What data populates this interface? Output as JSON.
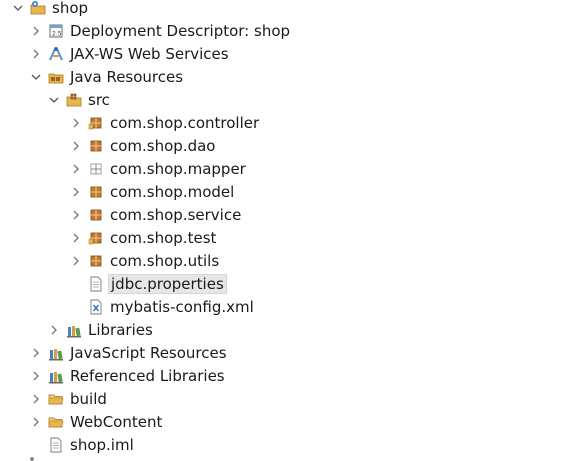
{
  "tree": {
    "project": {
      "label": "shop",
      "icon": "project-icon",
      "state": "expanded"
    },
    "deployment_descriptor": {
      "label": "Deployment Descriptor: shop",
      "icon": "deployment-descriptor-icon",
      "state": "collapsed"
    },
    "jaxws": {
      "label": "JAX-WS Web Services",
      "icon": "web-services-icon",
      "state": "collapsed"
    },
    "java_resources": {
      "label": "Java Resources",
      "icon": "java-resources-icon",
      "state": "expanded"
    },
    "src": {
      "label": "src",
      "icon": "source-folder-icon",
      "state": "expanded"
    },
    "packages": [
      {
        "label": "com.shop.controller",
        "icon": "package-icon",
        "state": "collapsed"
      },
      {
        "label": "com.shop.dao",
        "icon": "package-icon",
        "state": "collapsed"
      },
      {
        "label": "com.shop.mapper",
        "icon": "empty-package-icon",
        "state": "collapsed"
      },
      {
        "label": "com.shop.model",
        "icon": "package-icon",
        "state": "collapsed"
      },
      {
        "label": "com.shop.service",
        "icon": "package-icon",
        "state": "collapsed"
      },
      {
        "label": "com.shop.test",
        "icon": "package-icon",
        "state": "collapsed"
      },
      {
        "label": "com.shop.utils",
        "icon": "package-icon",
        "state": "collapsed"
      }
    ],
    "src_files": [
      {
        "label": "jdbc.properties",
        "icon": "properties-file-icon",
        "selected": true
      },
      {
        "label": "mybatis-config.xml",
        "icon": "xml-file-icon",
        "selected": false
      }
    ],
    "libraries": {
      "label": "Libraries",
      "icon": "libraries-icon",
      "state": "collapsed"
    },
    "javascript_resources": {
      "label": "JavaScript Resources",
      "icon": "javascript-resources-icon",
      "state": "collapsed"
    },
    "referenced_libraries": {
      "label": "Referenced Libraries",
      "icon": "referenced-libraries-icon",
      "state": "collapsed"
    },
    "build": {
      "label": "build",
      "icon": "folder-icon",
      "state": "collapsed"
    },
    "webcontent": {
      "label": "WebContent",
      "icon": "folder-icon",
      "state": "collapsed"
    },
    "shop_iml": {
      "label": "shop.iml",
      "icon": "file-icon"
    }
  },
  "colors": {
    "selection_bg": "#e6e6e6",
    "package_brown": "#a0642a",
    "folder_yellow": "#e8b64c"
  }
}
